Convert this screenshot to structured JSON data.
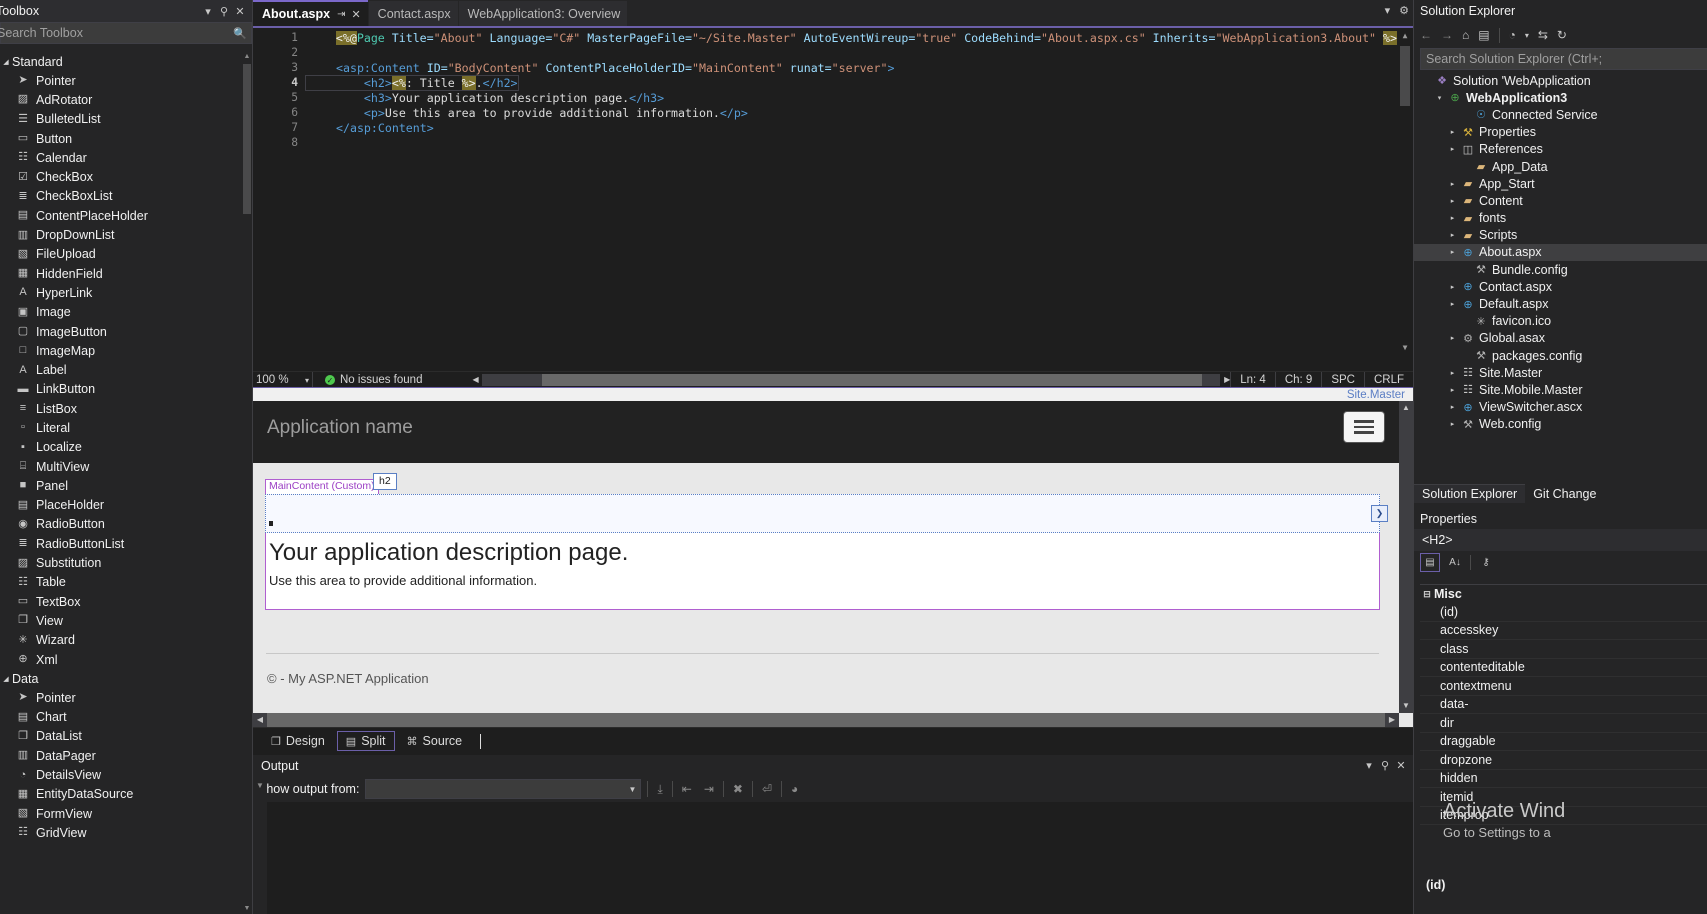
{
  "toolbox": {
    "title": "Toolbox",
    "search_placeholder": "Search Toolbox",
    "search_icon": "search-icon",
    "dropdown_icon": "chevron-down-icon",
    "pin_icon": "pin-icon",
    "close_icon": "close-icon",
    "groups": [
      {
        "label": "Standard",
        "expanded": true,
        "items": [
          {
            "label": "Pointer",
            "icon": "pointer-icon",
            "glyph": "➤"
          },
          {
            "label": "AdRotator",
            "icon": "adrotator-icon",
            "glyph": "▨"
          },
          {
            "label": "BulletedList",
            "icon": "bulletedlist-icon",
            "glyph": "☰"
          },
          {
            "label": "Button",
            "icon": "button-icon",
            "glyph": "▭"
          },
          {
            "label": "Calendar",
            "icon": "calendar-icon",
            "glyph": "☷"
          },
          {
            "label": "CheckBox",
            "icon": "checkbox-icon",
            "glyph": "☑"
          },
          {
            "label": "CheckBoxList",
            "icon": "checkboxlist-icon",
            "glyph": "≣"
          },
          {
            "label": "ContentPlaceHolder",
            "icon": "contentplaceholder-icon",
            "glyph": "▤"
          },
          {
            "label": "DropDownList",
            "icon": "dropdownlist-icon",
            "glyph": "▥"
          },
          {
            "label": "FileUpload",
            "icon": "fileupload-icon",
            "glyph": "▧"
          },
          {
            "label": "HiddenField",
            "icon": "hiddenfield-icon",
            "glyph": "▦"
          },
          {
            "label": "HyperLink",
            "icon": "hyperlink-icon",
            "glyph": "A"
          },
          {
            "label": "Image",
            "icon": "image-icon",
            "glyph": "▣"
          },
          {
            "label": "ImageButton",
            "icon": "imagebutton-icon",
            "glyph": "▢"
          },
          {
            "label": "ImageMap",
            "icon": "imagemap-icon",
            "glyph": "□"
          },
          {
            "label": "Label",
            "icon": "label-icon",
            "glyph": "A"
          },
          {
            "label": "LinkButton",
            "icon": "linkbutton-icon",
            "glyph": "▬"
          },
          {
            "label": "ListBox",
            "icon": "listbox-icon",
            "glyph": "≡"
          },
          {
            "label": "Literal",
            "icon": "literal-icon",
            "glyph": "▫"
          },
          {
            "label": "Localize",
            "icon": "localize-icon",
            "glyph": "▪"
          },
          {
            "label": "MultiView",
            "icon": "multiview-icon",
            "glyph": "⌸"
          },
          {
            "label": "Panel",
            "icon": "panel-icon",
            "glyph": "■"
          },
          {
            "label": "PlaceHolder",
            "icon": "placeholder-icon",
            "glyph": "▤"
          },
          {
            "label": "RadioButton",
            "icon": "radiobutton-icon",
            "glyph": "◉"
          },
          {
            "label": "RadioButtonList",
            "icon": "radiobuttonlist-icon",
            "glyph": "≣"
          },
          {
            "label": "Substitution",
            "icon": "substitution-icon",
            "glyph": "▨"
          },
          {
            "label": "Table",
            "icon": "table-icon",
            "glyph": "☷"
          },
          {
            "label": "TextBox",
            "icon": "textbox-icon",
            "glyph": "▭"
          },
          {
            "label": "View",
            "icon": "view-icon",
            "glyph": "❐"
          },
          {
            "label": "Wizard",
            "icon": "wizard-icon",
            "glyph": "✳"
          },
          {
            "label": "Xml",
            "icon": "xml-icon",
            "glyph": "⊕"
          }
        ]
      },
      {
        "label": "Data",
        "expanded": true,
        "items": [
          {
            "label": "Pointer",
            "icon": "pointer-icon",
            "glyph": "➤"
          },
          {
            "label": "Chart",
            "icon": "chart-icon",
            "glyph": "▤"
          },
          {
            "label": "DataList",
            "icon": "datalist-icon",
            "glyph": "❐"
          },
          {
            "label": "DataPager",
            "icon": "datapager-icon",
            "glyph": "▥"
          },
          {
            "label": "DetailsView",
            "icon": "detailsview-icon",
            "glyph": "◔"
          },
          {
            "label": "EntityDataSource",
            "icon": "entitydatasource-icon",
            "glyph": "▦"
          },
          {
            "label": "FormView",
            "icon": "formview-icon",
            "glyph": "▧"
          },
          {
            "label": "GridView",
            "icon": "gridview-icon",
            "glyph": "☷"
          }
        ]
      }
    ]
  },
  "tabs": {
    "items": [
      {
        "label": "About.aspx",
        "active": true,
        "pinned": true,
        "closable": true
      },
      {
        "label": "Contact.aspx",
        "active": false,
        "pinned": false,
        "closable": false
      },
      {
        "label": "WebApplication3: Overview",
        "active": false,
        "pinned": false,
        "closable": false
      }
    ],
    "pin_icon": "pin-icon",
    "close_icon": "close-icon",
    "chevron_icon": "chevron-down-icon",
    "gear_icon": "gear-icon"
  },
  "editor": {
    "lines": [
      {
        "n": "1",
        "current": false
      },
      {
        "n": "2",
        "current": false
      },
      {
        "n": "3",
        "current": false
      },
      {
        "n": "4",
        "current": true
      },
      {
        "n": "5",
        "current": false
      },
      {
        "n": "6",
        "current": false
      },
      {
        "n": "7",
        "current": false
      },
      {
        "n": "8",
        "current": false
      }
    ],
    "code": {
      "l1_open": "<%@",
      "l1_directive": "Page",
      "l1_a1": "Title=",
      "l1_v1": "\"About\"",
      "l1_a2": "Language=",
      "l1_v2": "\"C#\"",
      "l1_a3": "MasterPageFile=",
      "l1_v3": "\"~/Site.Master\"",
      "l1_a4": "AutoEventWireup=",
      "l1_v4": "\"true\"",
      "l1_a5": "CodeBehind=",
      "l1_v5": "\"About.aspx.cs\"",
      "l1_a6": "Inherits=",
      "l1_v6": "\"WebApplication3.About\"",
      "l1_close": "%>",
      "l3_tag": "<asp:Content",
      "l3_a1": "ID=",
      "l3_v1": "\"BodyContent\"",
      "l3_a2": "ContentPlaceHolderID=",
      "l3_v2": "\"MainContent\"",
      "l3_a3": "runat=",
      "l3_v3": "\"server\"",
      "l3_gt": ">",
      "l4_open": "<h2>",
      "l4_code_o": "<%",
      "l4_code_t": ": Title",
      "l4_code_c": "%>",
      "l4_dot": ".",
      "l4_close": "</h2>",
      "l5_open": "<h3>",
      "l5_text": "Your application description page.",
      "l5_close": "</h3>",
      "l6_open": "<p>",
      "l6_text": "Use this area to provide additional information.",
      "l6_close": "</p>",
      "l7": "</asp:Content>"
    },
    "status": {
      "zoom": "100 %",
      "zoom_caret": "chevron-down-icon",
      "issues_icon": "check-circle-icon",
      "issues": "No issues found",
      "line": "Ln: 4",
      "char": "Ch: 9",
      "spaces": "SPC",
      "eol": "CRLF"
    },
    "breadcrumb": "Site.Master"
  },
  "design": {
    "app_name": "Application name",
    "menu_icon": "hamburger-menu-icon",
    "placeholder_tag": "MainContent (Custom)",
    "h2_tag": "h2",
    "h2_handle_icon": "chevron-right-icon",
    "heading": "Your application description page.",
    "paragraph": "Use this area to provide additional information.",
    "footer": "© - My ASP.NET Application"
  },
  "view_tabs": {
    "items": [
      {
        "label": "Design",
        "icon": "design-view-icon",
        "glyph": "❐",
        "selected": false
      },
      {
        "label": "Split",
        "icon": "split-view-icon",
        "glyph": "▤",
        "selected": true
      },
      {
        "label": "Source",
        "icon": "source-view-icon",
        "glyph": "⌘",
        "selected": false
      }
    ]
  },
  "output": {
    "title": "Output",
    "show_from_label": "Show output from:",
    "show_from_value": "",
    "dropdown_icon": "chevron-down-icon",
    "chevron_icon": "chevron-down-icon",
    "pin_icon": "pin-icon",
    "close_icon": "close-icon",
    "toolbar_icons": [
      {
        "name": "find-message-icon",
        "glyph": "⤓"
      },
      {
        "name": "go-to-previous-icon",
        "glyph": "⇤"
      },
      {
        "name": "go-to-next-icon",
        "glyph": "⇥"
      },
      {
        "name": "clear-all-icon",
        "glyph": "✗"
      },
      {
        "name": "toggle-word-wrap-icon",
        "glyph": "↵"
      },
      {
        "name": "show-timestamps-icon",
        "glyph": "◴"
      }
    ]
  },
  "solution_explorer": {
    "title": "Solution Explorer",
    "search_placeholder": "Search Solution Explorer (Ctrl+;",
    "toolbar_icons": [
      {
        "name": "back-icon",
        "glyph": "←",
        "enabled": false
      },
      {
        "name": "forward-icon",
        "glyph": "→",
        "enabled": false
      },
      {
        "name": "home-icon",
        "glyph": "⌂",
        "enabled": true
      },
      {
        "name": "solution-views-icon",
        "glyph": "⌸",
        "enabled": true
      },
      {
        "name": "pending-changes-icon",
        "glyph": "◴",
        "enabled": true
      },
      {
        "name": "pending-changes-caret-icon",
        "glyph": "▾",
        "enabled": true
      },
      {
        "name": "sync-with-active-document-icon",
        "glyph": "⇆",
        "enabled": true
      },
      {
        "name": "refresh-icon",
        "glyph": "↻",
        "enabled": true
      }
    ],
    "tree": [
      {
        "label": "Solution 'WebApplication",
        "indent": 0,
        "expander": "",
        "icon": "solution-icon",
        "glyph": "❖",
        "gclass": "g-sol",
        "bold": false,
        "selected": false
      },
      {
        "label": "WebApplication3",
        "indent": 1,
        "expander": "▾",
        "icon": "web-project-icon",
        "glyph": "⊕",
        "gclass": "g-web",
        "bold": true,
        "selected": false
      },
      {
        "label": "Connected Service",
        "indent": 3,
        "expander": "",
        "icon": "connected-services-icon",
        "glyph": "☉",
        "gclass": "g-cloud",
        "bold": false,
        "selected": false
      },
      {
        "label": "Properties",
        "indent": 2,
        "expander": "▸",
        "icon": "properties-wrench-icon",
        "glyph": "⚒",
        "gclass": "g-wr",
        "bold": false,
        "selected": false
      },
      {
        "label": "References",
        "indent": 2,
        "expander": "▸",
        "icon": "references-icon",
        "glyph": "◫",
        "gclass": "g-ref",
        "bold": false,
        "selected": false
      },
      {
        "label": "App_Data",
        "indent": 3,
        "expander": "",
        "icon": "folder-icon",
        "glyph": "▰",
        "gclass": "g-fold",
        "bold": false,
        "selected": false
      },
      {
        "label": "App_Start",
        "indent": 2,
        "expander": "▸",
        "icon": "folder-icon",
        "glyph": "▰",
        "gclass": "g-fold",
        "bold": false,
        "selected": false
      },
      {
        "label": "Content",
        "indent": 2,
        "expander": "▸",
        "icon": "folder-icon",
        "glyph": "▰",
        "gclass": "g-fold",
        "bold": false,
        "selected": false
      },
      {
        "label": "fonts",
        "indent": 2,
        "expander": "▸",
        "icon": "folder-icon",
        "glyph": "▰",
        "gclass": "g-fold",
        "bold": false,
        "selected": false
      },
      {
        "label": "Scripts",
        "indent": 2,
        "expander": "▸",
        "icon": "folder-icon",
        "glyph": "▰",
        "gclass": "g-fold",
        "bold": false,
        "selected": false
      },
      {
        "label": "About.aspx",
        "indent": 2,
        "expander": "▸",
        "icon": "aspx-file-icon",
        "glyph": "⊕",
        "gclass": "g-aspx",
        "bold": false,
        "selected": true
      },
      {
        "label": "Bundle.config",
        "indent": 3,
        "expander": "",
        "icon": "config-file-icon",
        "glyph": "⚒",
        "gclass": "g-cfg",
        "bold": false,
        "selected": false
      },
      {
        "label": "Contact.aspx",
        "indent": 2,
        "expander": "▸",
        "icon": "aspx-file-icon",
        "glyph": "⊕",
        "gclass": "g-aspx",
        "bold": false,
        "selected": false
      },
      {
        "label": "Default.aspx",
        "indent": 2,
        "expander": "▸",
        "icon": "aspx-file-icon",
        "glyph": "⊕",
        "gclass": "g-aspx",
        "bold": false,
        "selected": false
      },
      {
        "label": "favicon.ico",
        "indent": 3,
        "expander": "",
        "icon": "icon-file-icon",
        "glyph": "✳",
        "gclass": "g-cfg",
        "bold": false,
        "selected": false
      },
      {
        "label": "Global.asax",
        "indent": 2,
        "expander": "▸",
        "icon": "asax-file-icon",
        "glyph": "⚙",
        "gclass": "g-cfg",
        "bold": false,
        "selected": false
      },
      {
        "label": "packages.config",
        "indent": 3,
        "expander": "",
        "icon": "config-file-icon",
        "glyph": "⚒",
        "gclass": "g-cfg",
        "bold": false,
        "selected": false
      },
      {
        "label": "Site.Master",
        "indent": 2,
        "expander": "▸",
        "icon": "master-page-icon",
        "glyph": "☷",
        "gclass": "g-mast",
        "bold": false,
        "selected": false
      },
      {
        "label": "Site.Mobile.Master",
        "indent": 2,
        "expander": "▸",
        "icon": "master-page-icon",
        "glyph": "☷",
        "gclass": "g-mast",
        "bold": false,
        "selected": false
      },
      {
        "label": "ViewSwitcher.ascx",
        "indent": 2,
        "expander": "▸",
        "icon": "ascx-control-icon",
        "glyph": "⊕",
        "gclass": "g-aspx",
        "bold": false,
        "selected": false
      },
      {
        "label": "Web.config",
        "indent": 2,
        "expander": "▸",
        "icon": "config-file-icon",
        "glyph": "⚒",
        "gclass": "g-cfg",
        "bold": false,
        "selected": false
      }
    ],
    "bottom_tabs": [
      {
        "label": "Solution Explorer",
        "active": true
      },
      {
        "label": "Git Change",
        "active": false
      }
    ]
  },
  "properties": {
    "title": "Properties",
    "object": "<H2>",
    "toolbar": [
      {
        "name": "categorized-icon",
        "glyph": "▤",
        "active": true
      },
      {
        "name": "alphabetical-sort-icon",
        "glyph": "↓",
        "active": false
      },
      {
        "name": "property-pages-icon",
        "glyph": "⚷",
        "active": false
      }
    ],
    "category": "Misc",
    "category_toggle_icon": "minus-box-icon",
    "rows": [
      {
        "key": "(id)",
        "value": ""
      },
      {
        "key": "accesskey",
        "value": ""
      },
      {
        "key": "class",
        "value": ""
      },
      {
        "key": "contenteditable",
        "value": ""
      },
      {
        "key": "contextmenu",
        "value": ""
      },
      {
        "key": "data-",
        "value": ""
      },
      {
        "key": "dir",
        "value": ""
      },
      {
        "key": "draggable",
        "value": ""
      },
      {
        "key": "dropzone",
        "value": ""
      },
      {
        "key": "hidden",
        "value": ""
      },
      {
        "key": "itemid",
        "value": ""
      },
      {
        "key": "itemprop",
        "value": ""
      }
    ],
    "footer_name": "(id)"
  },
  "watermark": {
    "line1": "Activate Wind",
    "line2": "Go to Settings to a"
  }
}
